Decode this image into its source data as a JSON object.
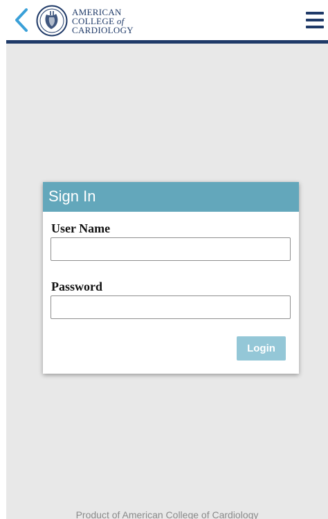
{
  "header": {
    "logo_lines": [
      "AMERICAN",
      "COLLEGE",
      "of",
      "CARDIOLOGY"
    ],
    "back_icon": "chevron-left-icon",
    "menu_icon": "hamburger-menu-icon",
    "brand_color": "#1f3a68",
    "back_color": "#3aa0d8"
  },
  "signin": {
    "title": "Sign In",
    "username_label": "User Name",
    "username_value": "",
    "password_label": "Password",
    "password_value": "",
    "login_label": "Login",
    "header_color": "#63a7bb",
    "button_color": "#94c7d7"
  },
  "footer": {
    "text": "Product of American College of Cardiology"
  }
}
